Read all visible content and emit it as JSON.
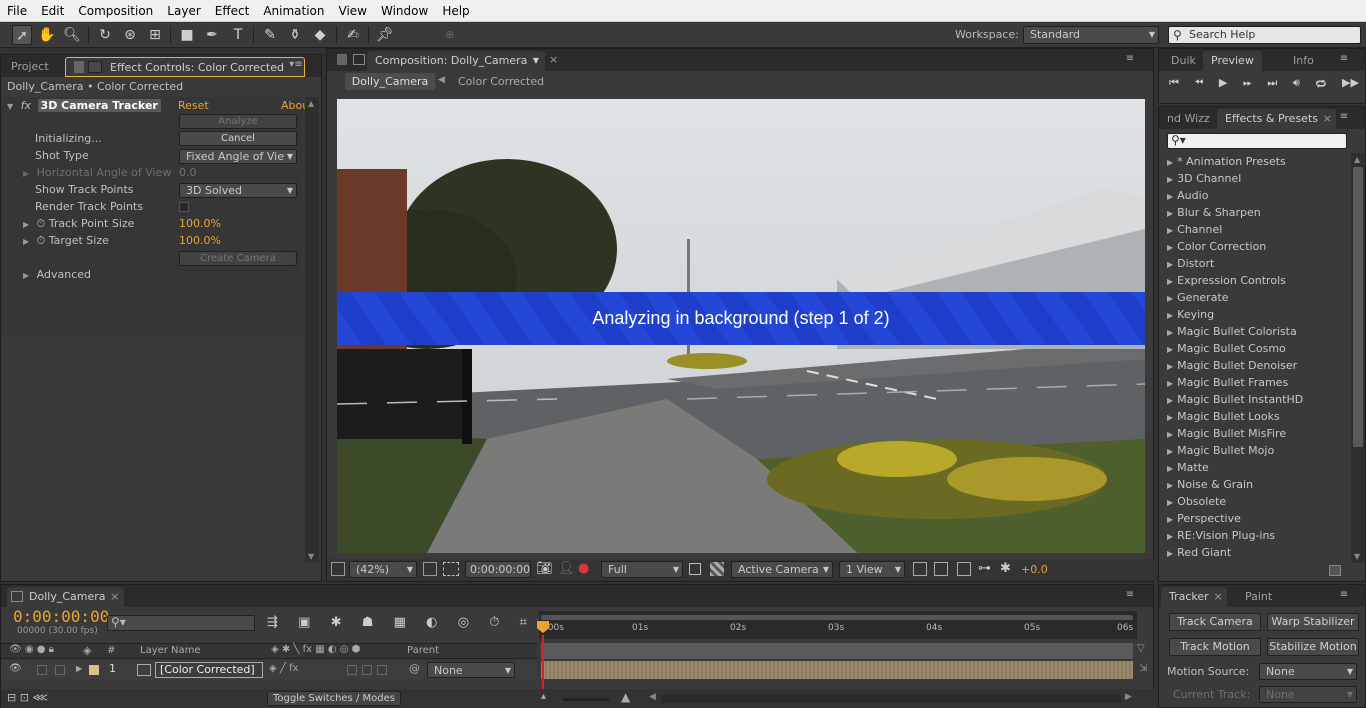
{
  "menubar": [
    "File",
    "Edit",
    "Composition",
    "Layer",
    "Effect",
    "Animation",
    "View",
    "Window",
    "Help"
  ],
  "toolbar": {
    "workspace_label": "Workspace:",
    "workspace_value": "Standard",
    "search_placeholder": "Search Help"
  },
  "left_panel": {
    "tabs": [
      "Project",
      "Effect Controls: Color Corrected"
    ],
    "breadcrumb": "Dolly_Camera • Color Corrected",
    "effect_name": "3D Camera Tracker",
    "reset": "Reset",
    "about": "Abou",
    "analyze_button": "Analyze",
    "initializing_label": "Initializing...",
    "cancel_button": "Cancel",
    "shot_type_label": "Shot Type",
    "shot_type_value": "Fixed Angle of View",
    "hfov_label": "Horizontal Angle of View",
    "hfov_value": "0.0",
    "show_track_points_label": "Show Track Points",
    "show_track_points_value": "3D Solved",
    "render_track_points_label": "Render Track Points",
    "track_point_size_label": "Track Point Size",
    "track_point_size_value": "100.0%",
    "target_size_label": "Target Size",
    "target_size_value": "100.0%",
    "create_camera_button": "Create Camera",
    "advanced_label": "Advanced"
  },
  "comp_panel": {
    "tab": "Composition: Dolly_Camera",
    "crumbs": [
      "Dolly_Camera",
      "Color Corrected"
    ],
    "banner_text": "Analyzing in background (step 1 of 2)",
    "zoom": "(42%)",
    "timecode": "0:00:00:00",
    "resolution": "Full",
    "camera": "Active Camera",
    "view": "1 View",
    "exposure": "+0.0"
  },
  "right_top": {
    "tabs": [
      "Duik",
      "Preview",
      "Info"
    ]
  },
  "effects_presets": {
    "tabs": [
      "nd Wizz",
      "Effects & Presets"
    ],
    "items": [
      "* Animation Presets",
      "3D Channel",
      "Audio",
      "Blur & Sharpen",
      "Channel",
      "Color Correction",
      "Distort",
      "Expression Controls",
      "Generate",
      "Keying",
      "Magic Bullet Colorista",
      "Magic Bullet Cosmo",
      "Magic Bullet Denoiser",
      "Magic Bullet Frames",
      "Magic Bullet InstantHD",
      "Magic Bullet Looks",
      "Magic Bullet MisFire",
      "Magic Bullet Mojo",
      "Matte",
      "Noise & Grain",
      "Obsolete",
      "Perspective",
      "RE:Vision Plug-ins",
      "Red Giant"
    ]
  },
  "timeline": {
    "tab": "Dolly_Camera",
    "timecode": "0:00:00:00",
    "fps": "00000 (30.00 fps)",
    "col_hash": "#",
    "col_layer_name": "Layer Name",
    "col_parent": "Parent",
    "layer_num": "1",
    "layer_name": "[Color Corrected]",
    "parent_value": "None",
    "toggle": "Toggle Switches / Modes",
    "ruler": [
      "0:00s",
      "01s",
      "02s",
      "03s",
      "04s",
      "05s",
      "06s"
    ]
  },
  "tracker": {
    "tabs": [
      "Tracker",
      "Paint"
    ],
    "track_camera": "Track Camera",
    "warp_stabilizer": "Warp Stabilizer",
    "track_motion": "Track Motion",
    "stabilize_motion": "Stabilize Motion",
    "motion_source_label": "Motion Source:",
    "motion_source_value": "None",
    "current_track_label": "Current Track:",
    "current_track_value": "None"
  }
}
